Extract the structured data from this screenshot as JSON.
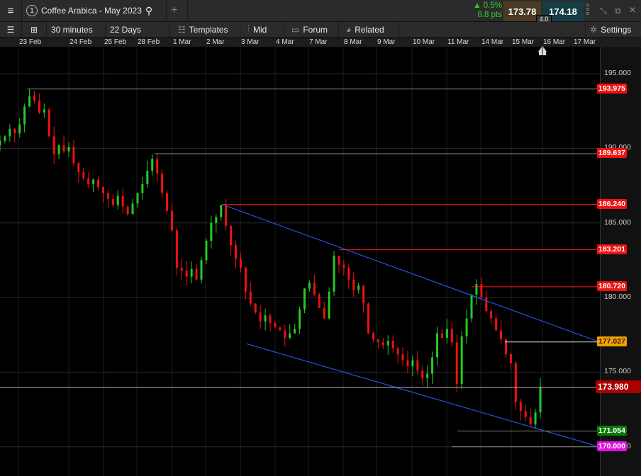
{
  "header": {
    "tab_number": "1",
    "instrument": "Coffee Arabica - May 2023",
    "change_pct": "▲ 0.5%",
    "change_pts": "8.8 pts",
    "sell": "173.78",
    "buy": "174.18",
    "spread": "4.0"
  },
  "toolbar": {
    "interval": "30 minutes",
    "range": "22 Days",
    "templates": "Templates",
    "price_type": "Mid",
    "forum": "Forum",
    "related": "Related",
    "settings": "Settings"
  },
  "dates": [
    "23 Feb",
    "24 Feb",
    "25 Feb",
    "28 Feb",
    "1 Mar",
    "2 Mar",
    "3 Mar",
    "4 Mar",
    "7 Mar",
    "8 Mar",
    "9 Mar",
    "10 Mar",
    "11 Mar",
    "14 Mar",
    "15 Mar",
    "16 Mar",
    "17 Mar"
  ],
  "axis_ticks": [
    "195.000",
    "190.000",
    "185.000",
    "180.000",
    "175.000",
    "170.000"
  ],
  "levels": [
    {
      "value": 193.975,
      "label": "193.975",
      "start": 38,
      "color": "#888",
      "bg": "#ee1111"
    },
    {
      "value": 189.637,
      "label": "189.637",
      "start": 218,
      "color": "#888",
      "bg": "#ee1111"
    },
    {
      "value": 186.24,
      "label": "186.240",
      "start": 313,
      "color": "#ff1a1a",
      "bg": "#ee1111"
    },
    {
      "value": 183.201,
      "label": "183.201",
      "start": 478,
      "color": "#ff1a1a",
      "bg": "#ee1111"
    },
    {
      "value": 180.72,
      "label": "180.720",
      "start": 665,
      "color": "#ff1a1a",
      "bg": "#ee1111"
    },
    {
      "value": 177.027,
      "label": "177.027",
      "start": 712,
      "color": "#ddd",
      "bg": "#f5a000"
    },
    {
      "value": 173.98,
      "label": "173.980",
      "start": 0,
      "color": "#bbb",
      "bg": "#aa0000"
    },
    {
      "value": 171.054,
      "label": "171.054",
      "start": 645,
      "color": "#888",
      "bg": "#0a7a0a"
    },
    {
      "value": 170.0,
      "label": "170.000",
      "start": 637,
      "color": "#888",
      "bg": "#e010e0"
    }
  ],
  "colors": {
    "up": "#22cc22",
    "down": "#ee1111",
    "channel": "#2255dd"
  },
  "chart_data": {
    "type": "candlestick",
    "title": "Coffee Arabica - May 2023",
    "ylim": [
      167,
      197.5
    ],
    "closes": [
      190.5,
      190.8,
      191.3,
      191.0,
      191.6,
      192.8,
      193.5,
      193.2,
      192.4,
      192.6,
      190.8,
      189.6,
      190.2,
      189.8,
      190.1,
      189.0,
      188.4,
      188.0,
      187.6,
      187.9,
      187.4,
      187.0,
      186.6,
      186.2,
      186.8,
      186.1,
      185.6,
      186.3,
      187.0,
      187.6,
      188.5,
      189.3,
      188.3,
      187.0,
      185.8,
      184.5,
      182.0,
      181.8,
      181.4,
      181.9,
      181.2,
      182.5,
      183.8,
      185.0,
      185.4,
      186.2,
      184.8,
      183.5,
      182.6,
      182.0,
      180.4,
      179.6,
      179.0,
      178.4,
      178.8,
      178.3,
      178.0,
      177.8,
      177.3,
      177.6,
      177.9,
      179.2,
      180.6,
      181.0,
      180.2,
      179.3,
      178.6,
      180.4,
      182.8,
      182.2,
      182.0,
      181.2,
      180.5,
      180.8,
      179.6,
      177.6,
      177.2,
      177.0,
      176.8,
      177.1,
      176.6,
      176.2,
      175.8,
      175.4,
      175.8,
      175.1,
      174.6,
      174.9,
      176.0,
      177.6,
      177.3,
      177.9,
      177.0,
      174.2,
      177.4,
      178.6,
      180.2,
      180.9,
      180.0,
      179.1,
      178.6,
      177.8,
      177.2,
      176.2,
      175.6,
      173.0,
      172.4,
      172.0,
      171.5,
      172.3,
      173.98
    ],
    "channel": {
      "upper": [
        186.24,
        177.027
      ],
      "lower": [
        176.9,
        170.0
      ]
    }
  }
}
